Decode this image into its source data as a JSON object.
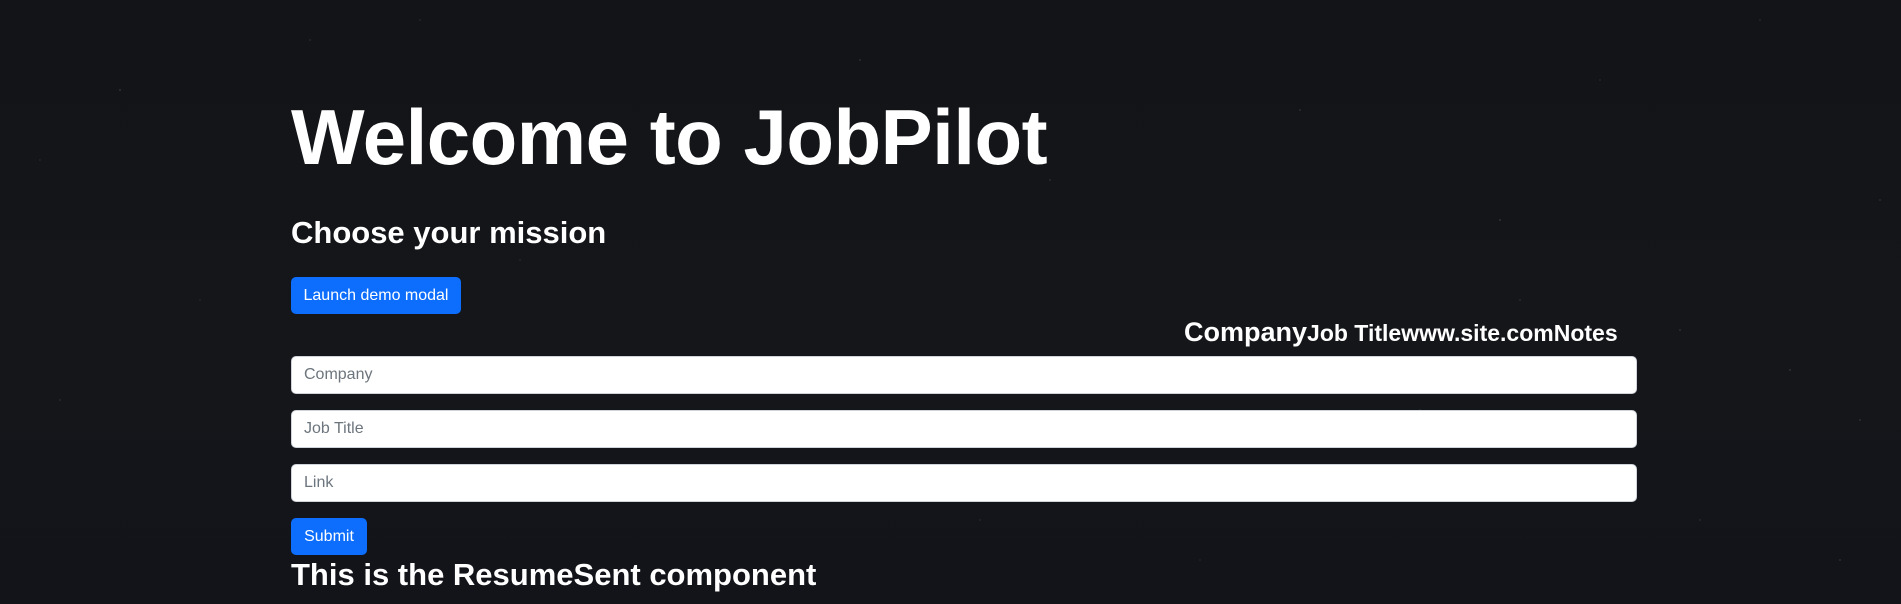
{
  "page": {
    "title": "Welcome to JobPilot",
    "subtitle": "Choose your mission"
  },
  "modal_button": {
    "label": "Launch demo modal"
  },
  "table_header": {
    "company": "Company",
    "job_title": "Job Title",
    "link": "www.site.com",
    "notes": "Notes"
  },
  "form": {
    "company": {
      "value": "",
      "placeholder": "Company"
    },
    "job_title": {
      "value": "",
      "placeholder": "Job Title"
    },
    "link": {
      "value": "",
      "placeholder": "Link"
    },
    "submit_label": "Submit"
  },
  "resume_sent": {
    "heading": "This is the ResumeSent component"
  },
  "colors": {
    "background": "#121417",
    "primary_button": "#0d6efd",
    "text": "#ffffff",
    "input_background": "#ffffff",
    "placeholder": "#6c757d"
  }
}
